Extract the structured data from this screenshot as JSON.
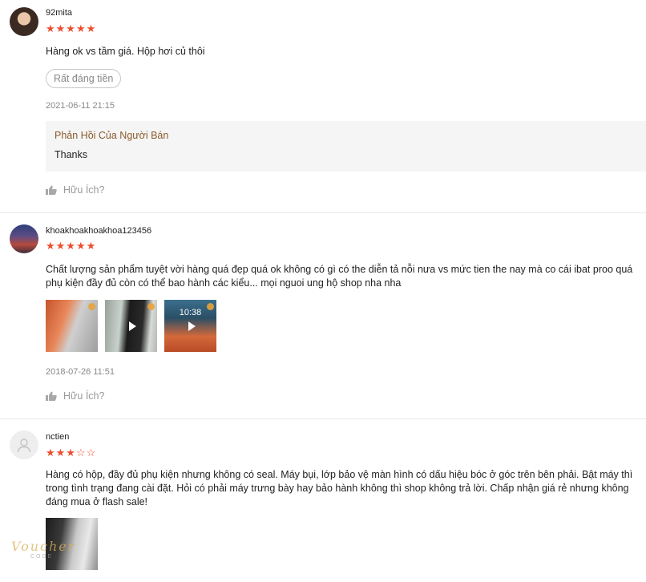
{
  "reviews": [
    {
      "username": "92mita",
      "rating": 5,
      "stars_text": "★★★★★",
      "content": "Hàng ok vs tầm giá. Hộp hơi củ thôi",
      "tag": "Rất đáng tiền",
      "date": "2021-06-11 21:15",
      "seller_reply": {
        "title": "Phản Hồi Của Người Bán",
        "text": "Thanks"
      },
      "helpful_label": "Hữu Ích?"
    },
    {
      "username": "khoakhoakhoakhoa123456",
      "rating": 5,
      "stars_text": "★★★★★",
      "content": " Chất lượng sản phẩm tuyệt vời hàng quá đẹp quá ok không có gì có the diễn tả nỗi nưa vs mức tien the nay mà co cái ibat proo quá phụ kiện đầy đủ còn có thể bao hành các kiểu... mọi nguoi ung hộ shop nha nha",
      "media_clock": "10:38",
      "date": "2018-07-26 11:51",
      "helpful_label": "Hữu Ích?"
    },
    {
      "username": "nctien",
      "rating": 3,
      "stars_filled": "★★★",
      "stars_empty": "☆☆",
      "content": "Hàng có hộp, đầy đủ phụ kiện nhưng không có seal. Máy bụi, lớp bảo vệ màn hình có dấu hiệu bóc ở góc trên bên phải. Bật máy thì trong tình trạng đang cài đặt. Hỏi có phải máy trưng bày hay bảo hành không thì shop không trả lời. Chấp nhận giá rẻ nhưng không đáng mua ở flash sale!"
    }
  ],
  "watermark": {
    "text": "Voucher",
    "sub": "CODE"
  },
  "colors": {
    "star": "#ee4d2d",
    "reply_title": "#8a5a2b",
    "muted": "#888888"
  },
  "icons": [
    "thumbs-up-icon",
    "play-icon",
    "user-placeholder-icon",
    "more-options-icon"
  ]
}
